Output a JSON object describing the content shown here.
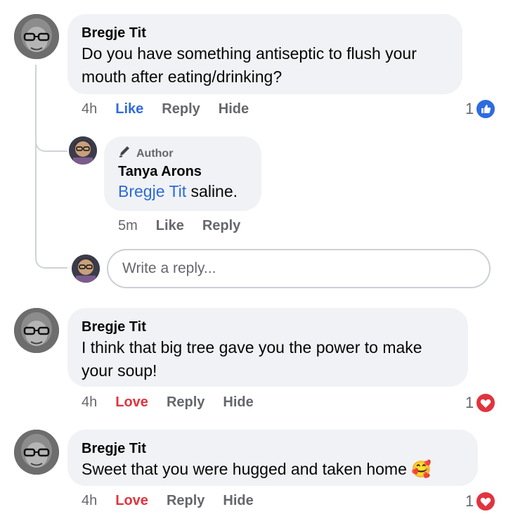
{
  "comments": [
    {
      "author": "Bregje Tit",
      "text": "Do you have something antiseptic to flush your mouth after eating/drinking?",
      "time": "4h",
      "action_react": "Like",
      "action_reply": "Reply",
      "action_hide": "Hide",
      "reaction_count": "1",
      "reaction_type": "like-icon"
    },
    {
      "badge": "Author",
      "author": "Tanya Arons",
      "mention": "Bregje Tit",
      "text": " saline.",
      "time": "5m",
      "action_react": "Like",
      "action_reply": "Reply"
    },
    {
      "author": "Bregje Tit",
      "text": "I think that big tree gave you the power to make your soup!",
      "time": "4h",
      "action_react": "Love",
      "action_reply": "Reply",
      "action_hide": "Hide",
      "reaction_count": "1",
      "reaction_type": "heart-icon"
    },
    {
      "author": "Bregje Tit",
      "text": "Sweet that you were hugged and taken home ",
      "emoji": "🥰",
      "time": "4h",
      "action_react": "Love",
      "action_reply": "Reply",
      "action_hide": "Hide",
      "reaction_count": "1",
      "reaction_type": "heart-icon"
    }
  ],
  "reply_box": {
    "placeholder": "Write a reply..."
  },
  "colors": {
    "like": "#2f6be0",
    "love": "#e0343f",
    "bubble": "#f0f2f5",
    "muted": "#65676b"
  }
}
